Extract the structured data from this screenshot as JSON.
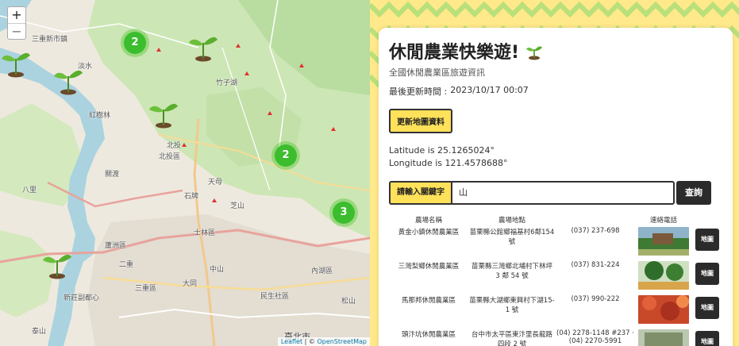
{
  "map": {
    "zoom_in": "+",
    "zoom_out": "−",
    "clusters": [
      "2",
      "2",
      "3"
    ],
    "labels": [
      "三重新市鎮",
      "竹子湖",
      "北投區",
      "士林區",
      "天母",
      "大同",
      "內湖區",
      "蘆洲區",
      "三重區",
      "新莊副都心",
      "臺北市",
      "民生社區",
      "北投",
      "石牌",
      "芝山",
      "關渡",
      "八里",
      "紅樹林",
      "淡水",
      "泰山",
      "二重",
      "松山",
      "中山"
    ],
    "attribution_link": "Leaflet",
    "attribution_sep": " | © ",
    "attribution_osm": "OpenStreetMap"
  },
  "panel": {
    "title": "休閒農業快樂遊!",
    "subtitle": "全國休閒農業區旅遊資訊",
    "updated_label": "最後更新時間 :",
    "updated_value": "2023/10/17 00:07",
    "refresh_button": "更新地圖資料",
    "latitude_text": "Latitude is 25.1265024°",
    "longitude_text": "Longitude is 121.4578688°",
    "search_label": "請輸入關鍵字",
    "search_value": "山",
    "search_button": "查詢",
    "table": {
      "headers": [
        "農場名稱",
        "農場地點",
        "連絡電話"
      ],
      "map_button": "地圖",
      "rows": [
        {
          "name": "黃金小鎮休閒農業區",
          "location": "苗栗縣公館鄉福基村6鄰154號",
          "phone": "(037) 237-698"
        },
        {
          "name": "三灣梨鄉休閒農業區",
          "location": "苗栗縣三灣鄉北埔村下林坪 3 鄰 54 號",
          "phone": "(037) 831-224"
        },
        {
          "name": "馬那邦休閒農業區",
          "location": "苗栗縣大湖鄉東興村下湖15-1 號",
          "phone": "(037) 990-222"
        },
        {
          "name": "頭汴坑休閒農業區",
          "location": "台中市太平區東汴里長龍路四段 2 號",
          "phone": "(04) 2278-1148 #237 · (04) 2270-5991"
        }
      ]
    }
  },
  "colors": {
    "accent_yellow": "#ffe15a",
    "cluster_green": "#3bbd2e",
    "dark_button": "#2b2b2b",
    "background_zigzag": "#ffe98a"
  }
}
